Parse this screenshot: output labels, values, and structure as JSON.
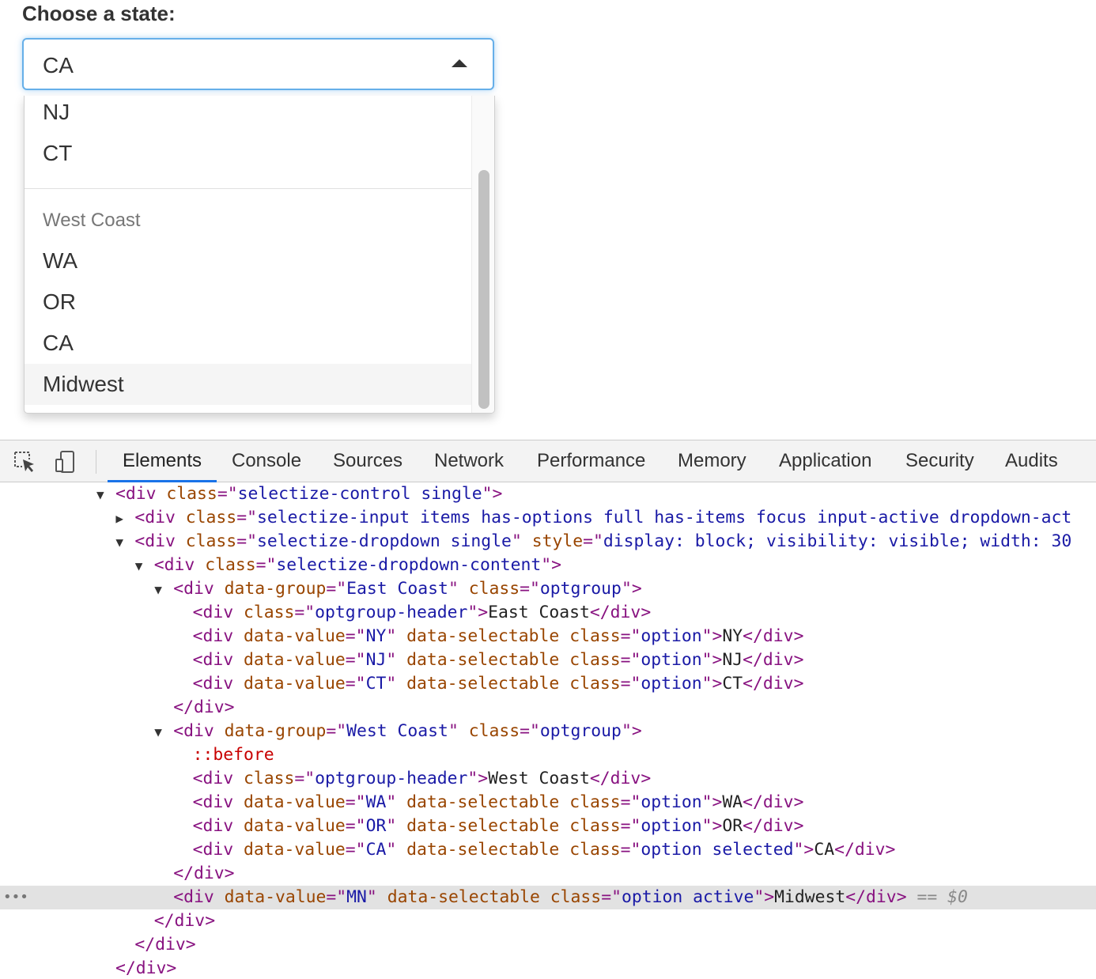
{
  "selectize": {
    "label": "Choose a state:",
    "selected_value": "CA",
    "dropdown": {
      "options_top": [
        "NJ",
        "CT"
      ],
      "group_header": "West Coast",
      "options_west": [
        "WA",
        "OR",
        "CA"
      ],
      "active_option": "Midwest"
    }
  },
  "devtools": {
    "tabs": [
      "Elements",
      "Console",
      "Sources",
      "Network",
      "Performance",
      "Memory",
      "Application",
      "Security",
      "Audits"
    ],
    "active_tab": "Elements",
    "lines": [
      {
        "indent": 5,
        "arrow": "▼",
        "html": "<span class=\"tag\">&lt;div</span> <span class=\"attr\">class</span><span class=\"tag\">=\"</span><span class=\"val\">selectize-control single</span><span class=\"tag\">\"&gt;</span>"
      },
      {
        "indent": 6,
        "arrow": "▶",
        "html": "<span class=\"tag\">&lt;div</span> <span class=\"attr\">class</span><span class=\"tag\">=\"</span><span class=\"val\">selectize-input items has-options full has-items focus input-active dropdown-act</span>"
      },
      {
        "indent": 6,
        "arrow": "▼",
        "html": "<span class=\"tag\">&lt;div</span> <span class=\"attr\">class</span><span class=\"tag\">=\"</span><span class=\"val\">selectize-dropdown single</span><span class=\"tag\">\"</span> <span class=\"attr\">style</span><span class=\"tag\">=\"</span><span class=\"val\">display: block; visibility: visible; width: 30</span>"
      },
      {
        "indent": 7,
        "arrow": "▼",
        "html": "<span class=\"tag\">&lt;div</span> <span class=\"attr\">class</span><span class=\"tag\">=\"</span><span class=\"val\">selectize-dropdown-content</span><span class=\"tag\">\"&gt;</span>"
      },
      {
        "indent": 8,
        "arrow": "▼",
        "html": "<span class=\"tag\">&lt;div</span> <span class=\"attr\">data-group</span><span class=\"tag\">=\"</span><span class=\"val\">East Coast</span><span class=\"tag\">\"</span> <span class=\"attr\">class</span><span class=\"tag\">=\"</span><span class=\"val\">optgroup</span><span class=\"tag\">\"&gt;</span>"
      },
      {
        "indent": 9,
        "arrow": "",
        "html": "<span class=\"tag\">&lt;div</span> <span class=\"attr\">class</span><span class=\"tag\">=\"</span><span class=\"val\">optgroup-header</span><span class=\"tag\">\"&gt;</span><span class=\"txt\">East Coast</span><span class=\"tag\">&lt;/div&gt;</span>"
      },
      {
        "indent": 9,
        "arrow": "",
        "html": "<span class=\"tag\">&lt;div</span> <span class=\"attr\">data-value</span><span class=\"tag\">=\"</span><span class=\"val\">NY</span><span class=\"tag\">\"</span> <span class=\"attr\">data-selectable</span> <span class=\"attr\">class</span><span class=\"tag\">=\"</span><span class=\"val\">option</span><span class=\"tag\">\"&gt;</span><span class=\"txt\">NY</span><span class=\"tag\">&lt;/div&gt;</span>"
      },
      {
        "indent": 9,
        "arrow": "",
        "html": "<span class=\"tag\">&lt;div</span> <span class=\"attr\">data-value</span><span class=\"tag\">=\"</span><span class=\"val\">NJ</span><span class=\"tag\">\"</span> <span class=\"attr\">data-selectable</span> <span class=\"attr\">class</span><span class=\"tag\">=\"</span><span class=\"val\">option</span><span class=\"tag\">\"&gt;</span><span class=\"txt\">NJ</span><span class=\"tag\">&lt;/div&gt;</span>"
      },
      {
        "indent": 9,
        "arrow": "",
        "html": "<span class=\"tag\">&lt;div</span> <span class=\"attr\">data-value</span><span class=\"tag\">=\"</span><span class=\"val\">CT</span><span class=\"tag\">\"</span> <span class=\"attr\">data-selectable</span> <span class=\"attr\">class</span><span class=\"tag\">=\"</span><span class=\"val\">option</span><span class=\"tag\">\"&gt;</span><span class=\"txt\">CT</span><span class=\"tag\">&lt;/div&gt;</span>"
      },
      {
        "indent": 8,
        "arrow": "",
        "html": "<span class=\"tag\">&lt;/div&gt;</span>"
      },
      {
        "indent": 8,
        "arrow": "▼",
        "html": "<span class=\"tag\">&lt;div</span> <span class=\"attr\">data-group</span><span class=\"tag\">=\"</span><span class=\"val\">West Coast</span><span class=\"tag\">\"</span> <span class=\"attr\">class</span><span class=\"tag\">=\"</span><span class=\"val\">optgroup</span><span class=\"tag\">\"&gt;</span>"
      },
      {
        "indent": 9,
        "arrow": "",
        "html": "<span class=\"pseudo\">::before</span>"
      },
      {
        "indent": 9,
        "arrow": "",
        "html": "<span class=\"tag\">&lt;div</span> <span class=\"attr\">class</span><span class=\"tag\">=\"</span><span class=\"val\">optgroup-header</span><span class=\"tag\">\"&gt;</span><span class=\"txt\">West Coast</span><span class=\"tag\">&lt;/div&gt;</span>"
      },
      {
        "indent": 9,
        "arrow": "",
        "html": "<span class=\"tag\">&lt;div</span> <span class=\"attr\">data-value</span><span class=\"tag\">=\"</span><span class=\"val\">WA</span><span class=\"tag\">\"</span> <span class=\"attr\">data-selectable</span> <span class=\"attr\">class</span><span class=\"tag\">=\"</span><span class=\"val\">option</span><span class=\"tag\">\"&gt;</span><span class=\"txt\">WA</span><span class=\"tag\">&lt;/div&gt;</span>"
      },
      {
        "indent": 9,
        "arrow": "",
        "html": "<span class=\"tag\">&lt;div</span> <span class=\"attr\">data-value</span><span class=\"tag\">=\"</span><span class=\"val\">OR</span><span class=\"tag\">\"</span> <span class=\"attr\">data-selectable</span> <span class=\"attr\">class</span><span class=\"tag\">=\"</span><span class=\"val\">option</span><span class=\"tag\">\"&gt;</span><span class=\"txt\">OR</span><span class=\"tag\">&lt;/div&gt;</span>"
      },
      {
        "indent": 9,
        "arrow": "",
        "html": "<span class=\"tag\">&lt;div</span> <span class=\"attr\">data-value</span><span class=\"tag\">=\"</span><span class=\"val\">CA</span><span class=\"tag\">\"</span> <span class=\"attr\">data-selectable</span> <span class=\"attr\">class</span><span class=\"tag\">=\"</span><span class=\"val\">option selected</span><span class=\"tag\">\"&gt;</span><span class=\"txt\">CA</span><span class=\"tag\">&lt;/div&gt;</span>"
      },
      {
        "indent": 8,
        "arrow": "",
        "html": "<span class=\"tag\">&lt;/div&gt;</span>"
      },
      {
        "indent": 8,
        "arrow": "",
        "highlight": true,
        "html": "<span class=\"tag\">&lt;div</span> <span class=\"attr\">data-value</span><span class=\"tag\">=\"</span><span class=\"val\">MN</span><span class=\"tag\">\"</span> <span class=\"attr\">data-selectable</span> <span class=\"attr\">class</span><span class=\"tag\">=\"</span><span class=\"val\">option active</span><span class=\"tag\">\"&gt;</span><span class=\"txt\">Midwest</span><span class=\"tag\">&lt;/div&gt;</span> <span class=\"dollar\">== $0</span>"
      },
      {
        "indent": 7,
        "arrow": "",
        "html": "<span class=\"tag\">&lt;/div&gt;</span>"
      },
      {
        "indent": 6,
        "arrow": "",
        "html": "<span class=\"tag\">&lt;/div&gt;</span>"
      },
      {
        "indent": 5,
        "arrow": "",
        "html": "<span class=\"tag\">&lt;/div&gt;</span>"
      }
    ]
  }
}
